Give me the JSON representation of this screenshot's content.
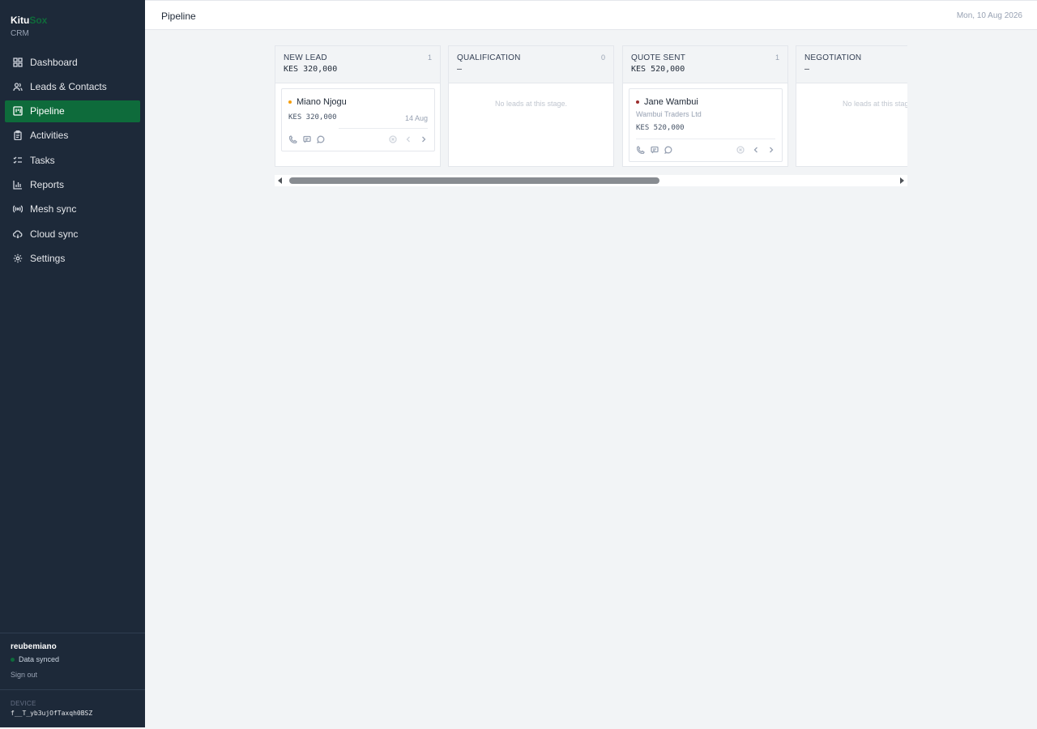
{
  "app": {
    "brand_main": "Kitu",
    "brand_accent": "Sox",
    "brand_sub": "CRM",
    "accent_color": "#0e6b3b"
  },
  "sidebar": {
    "items": [
      {
        "label": "Dashboard",
        "icon": "grid-icon"
      },
      {
        "label": "Leads & Contacts",
        "icon": "users-icon"
      },
      {
        "label": "Pipeline",
        "icon": "kanban-icon",
        "active": true
      },
      {
        "label": "Activities",
        "icon": "clipboard-icon"
      },
      {
        "label": "Tasks",
        "icon": "checklist-icon"
      },
      {
        "label": "Reports",
        "icon": "bar-chart-icon"
      },
      {
        "label": "Mesh sync",
        "icon": "radio-icon"
      },
      {
        "label": "Cloud sync",
        "icon": "cloud-sync-icon"
      },
      {
        "label": "Settings",
        "icon": "gear-icon"
      }
    ],
    "user": {
      "name": "reubemiano",
      "status": "Data synced",
      "sign_out": "Sign out"
    },
    "device": {
      "label": "DEVICE",
      "id": "f__T_yb3ujOfTaxqh0BSZ"
    }
  },
  "header": {
    "title": "Pipeline",
    "date": "Mon, 10 Aug 2026"
  },
  "board": {
    "columns": [
      {
        "name": "NEW LEAD",
        "count": "1",
        "total": "KES 320,000",
        "cards": [
          {
            "name": "Miano Njogu",
            "dot_color": "#f59e0b",
            "amount": "KES 320,000",
            "date": "14 Aug"
          }
        ]
      },
      {
        "name": "QUALIFICATION",
        "count": "0",
        "total": "–",
        "empty": "No leads at this stage."
      },
      {
        "name": "QUOTE SENT",
        "count": "1",
        "total": "KES 520,000",
        "cards": [
          {
            "name": "Jane Wambui",
            "dot_color": "#9b2c2c",
            "company": "Wambui Traders Ltd",
            "amount": "KES 520,000"
          }
        ]
      },
      {
        "name": "NEGOTIATION",
        "count": "",
        "total": "–",
        "empty": "No leads at this stage."
      }
    ]
  }
}
